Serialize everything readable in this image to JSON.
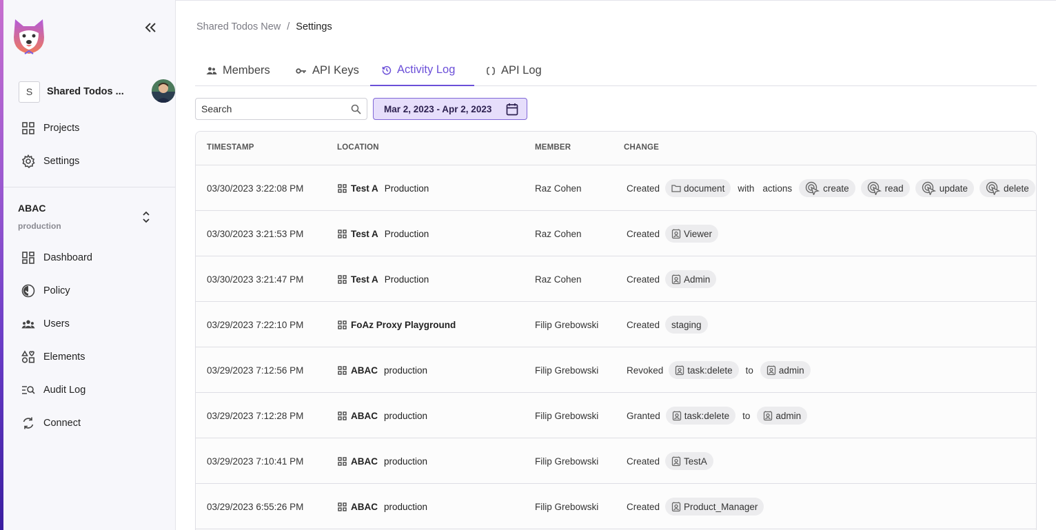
{
  "app": {
    "accent_gradient": [
      "#c76fcf",
      "#6a3cc6",
      "#3a1ea0"
    ],
    "active_color": "#6b4fd8"
  },
  "sidebar": {
    "workspace": {
      "badge": "S",
      "name": "Shared Todos ..."
    },
    "top_nav": [
      {
        "label": "Projects",
        "icon": "grid-icon"
      },
      {
        "label": "Settings",
        "icon": "gear-icon"
      }
    ],
    "environment": {
      "project": "ABAC",
      "env": "production"
    },
    "env_nav": [
      {
        "label": "Dashboard",
        "icon": "dashboard-icon"
      },
      {
        "label": "Policy",
        "icon": "policy-icon"
      },
      {
        "label": "Users",
        "icon": "users-icon"
      },
      {
        "label": "Elements",
        "icon": "elements-icon"
      },
      {
        "label": "Audit Log",
        "icon": "audit-log-icon"
      },
      {
        "label": "Connect",
        "icon": "sync-icon"
      }
    ]
  },
  "breadcrumb": {
    "parent": "Shared Todos New",
    "separator": "/",
    "current": "Settings"
  },
  "tabs": [
    {
      "label": "Members",
      "icon": "people-icon",
      "active": false
    },
    {
      "label": "API Keys",
      "icon": "key-icon",
      "active": false
    },
    {
      "label": "Activity Log",
      "icon": "history-icon",
      "active": true
    },
    {
      "label": "API Log",
      "icon": "code-icon",
      "active": false
    }
  ],
  "filters": {
    "search_placeholder": "Search",
    "date_range": "Mar 2, 2023 - Apr 2, 2023"
  },
  "table": {
    "headers": {
      "timestamp": "TIMESTAMP",
      "location": "LOCATION",
      "member": "MEMBER",
      "change": "CHANGE"
    },
    "rows": [
      {
        "timestamp": "03/30/2023 3:22:08 PM",
        "project": "Test A",
        "env": "Production",
        "member": "Raz Cohen",
        "verb": "Created",
        "chips": [
          {
            "t": "chip",
            "icon": "folder",
            "label": "document"
          },
          {
            "t": "text",
            "label": "with"
          },
          {
            "t": "text",
            "label": "actions"
          },
          {
            "t": "chip",
            "icon": "action",
            "label": "create"
          },
          {
            "t": "chip",
            "icon": "action",
            "label": "read"
          },
          {
            "t": "chip",
            "icon": "action",
            "label": "update"
          },
          {
            "t": "chip",
            "icon": "action",
            "label": "delete"
          }
        ]
      },
      {
        "timestamp": "03/30/2023 3:21:53 PM",
        "project": "Test A",
        "env": "Production",
        "member": "Raz Cohen",
        "verb": "Created",
        "chips": [
          {
            "t": "chip",
            "icon": "role",
            "label": "Viewer"
          }
        ]
      },
      {
        "timestamp": "03/30/2023 3:21:47 PM",
        "project": "Test A",
        "env": "Production",
        "member": "Raz Cohen",
        "verb": "Created",
        "chips": [
          {
            "t": "chip",
            "icon": "role",
            "label": "Admin"
          }
        ]
      },
      {
        "timestamp": "03/29/2023 7:22:10 PM",
        "project": "FoAz Proxy Playground",
        "env": "",
        "member": "Filip Grebowski",
        "verb": "Created",
        "chips": [
          {
            "t": "chip",
            "icon": "",
            "label": "staging"
          }
        ]
      },
      {
        "timestamp": "03/29/2023 7:12:56 PM",
        "project": "ABAC",
        "env": "production",
        "member": "Filip Grebowski",
        "verb": "Revoked",
        "chips": [
          {
            "t": "chip",
            "icon": "role",
            "label": "task:delete"
          },
          {
            "t": "text",
            "label": "to"
          },
          {
            "t": "chip",
            "icon": "role",
            "label": "admin"
          }
        ]
      },
      {
        "timestamp": "03/29/2023 7:12:28 PM",
        "project": "ABAC",
        "env": "production",
        "member": "Filip Grebowski",
        "verb": "Granted",
        "chips": [
          {
            "t": "chip",
            "icon": "role",
            "label": "task:delete"
          },
          {
            "t": "text",
            "label": "to"
          },
          {
            "t": "chip",
            "icon": "role",
            "label": "admin"
          }
        ]
      },
      {
        "timestamp": "03/29/2023 7:10:41 PM",
        "project": "ABAC",
        "env": "production",
        "member": "Filip Grebowski",
        "verb": "Created",
        "chips": [
          {
            "t": "chip",
            "icon": "role",
            "label": "TestA"
          }
        ]
      },
      {
        "timestamp": "03/29/2023 6:55:26 PM",
        "project": "ABAC",
        "env": "production",
        "member": "Filip Grebowski",
        "verb": "Created",
        "chips": [
          {
            "t": "chip",
            "icon": "role",
            "label": "Product_Manager"
          }
        ]
      }
    ]
  }
}
